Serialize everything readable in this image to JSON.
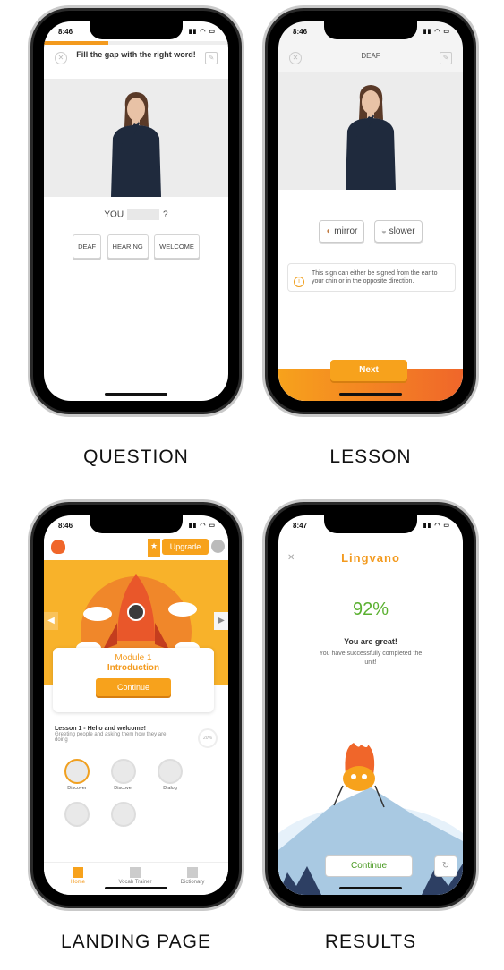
{
  "status": {
    "time_a": "8:46",
    "time_b": "8:47"
  },
  "question": {
    "title": "Fill the gap with the right word!",
    "prompt_pre": "YOU",
    "prompt_post": "?",
    "options": [
      "DEAF",
      "HEARING",
      "WELCOME"
    ],
    "caption": "QUESTION",
    "progress": 0.35
  },
  "lesson": {
    "title": "DEAF",
    "mirror_label": "mirror",
    "slower_label": "slower",
    "info_text": "This sign can either be signed from the ear to your chin or in the opposite direction.",
    "next_label": "Next",
    "caption": "LESSON"
  },
  "landing": {
    "upgrade_label": "Upgrade",
    "module_number": "Module 1",
    "module_name": "Introduction",
    "continue_label": "Continue",
    "lesson_title": "Lesson 1 - Hello and welcome!",
    "lesson_subtitle": "Greeting people and asking them how they are doing",
    "lesson_progress_text": "20%",
    "steps": [
      "Discover",
      "Discover",
      "Dialog"
    ],
    "tabs": [
      "Home",
      "Vocab Trainer",
      "Dictionary"
    ],
    "caption": "LANDING PAGE"
  },
  "results": {
    "brand": "Lingvano",
    "score": "92%",
    "headline": "You are great!",
    "message": "You have successfully completed the unit!",
    "continue_label": "Continue",
    "caption": "RESULTS"
  },
  "colors": {
    "accent": "#f7a21c",
    "success": "#5ab030"
  }
}
